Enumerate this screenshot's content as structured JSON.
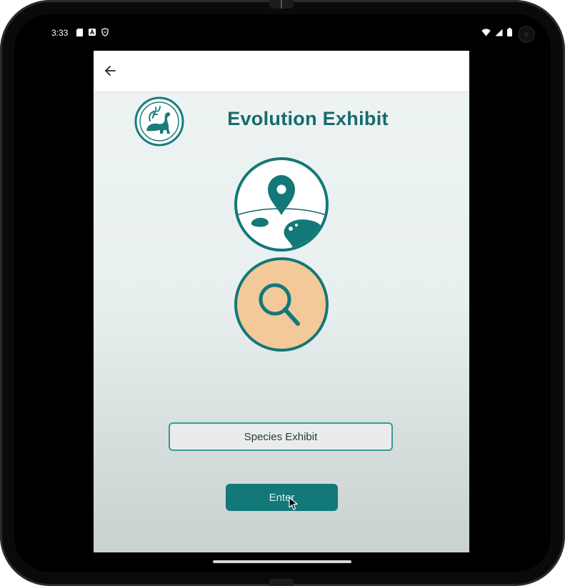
{
  "status_bar": {
    "time": "3:33",
    "left_icons": [
      "sd-card-icon",
      "a-notification-icon",
      "shield-icon"
    ],
    "right_icons": [
      "wifi-icon",
      "signal-icon",
      "battery-icon"
    ]
  },
  "app": {
    "title": "Evolution Exhibit",
    "logo_icon": "dinosaur-logo-icon",
    "map_icon": "map-pin-globe-icon",
    "search_icon": "magnifier-icon",
    "exhibit_field": {
      "value": "Species Exhibit"
    },
    "enter_label": "Enter"
  },
  "colors": {
    "accent": "#137878",
    "title": "#176a6a",
    "search_fill": "#f3c99a",
    "map_fill": "#ffffff"
  }
}
